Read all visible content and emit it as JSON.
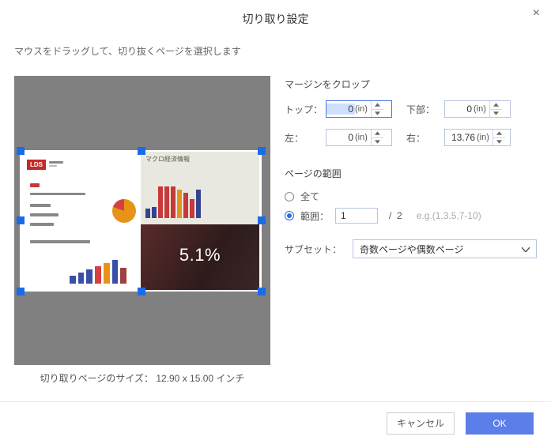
{
  "title": "切り取り設定",
  "instructions": "マウスをドラッグして、切り抜くページを選択します",
  "preview": {
    "lds_badge": "LDS",
    "percent_label": "5.1%",
    "size_label": "切り取りページのサイズ：  12.90 x 15.00 インチ"
  },
  "margins": {
    "group_title": "マージンをクロップ",
    "top_label": "トップ：",
    "bottom_label": "下部：",
    "left_label": "左：",
    "right_label": "右：",
    "top_value": "0",
    "bottom_value": "0",
    "left_value": "0",
    "right_value": "13.76",
    "unit": "(in)"
  },
  "range": {
    "group_title": "ページの範囲",
    "all_label": "全て",
    "range_label": "範囲：",
    "range_value": "1",
    "total": "2",
    "hint": "e.g.(1,3,5,7-10)"
  },
  "subset": {
    "label": "サブセット：",
    "selected": "奇数ページや偶数ページ"
  },
  "footer": {
    "cancel": "キャンセル",
    "ok": "OK"
  }
}
